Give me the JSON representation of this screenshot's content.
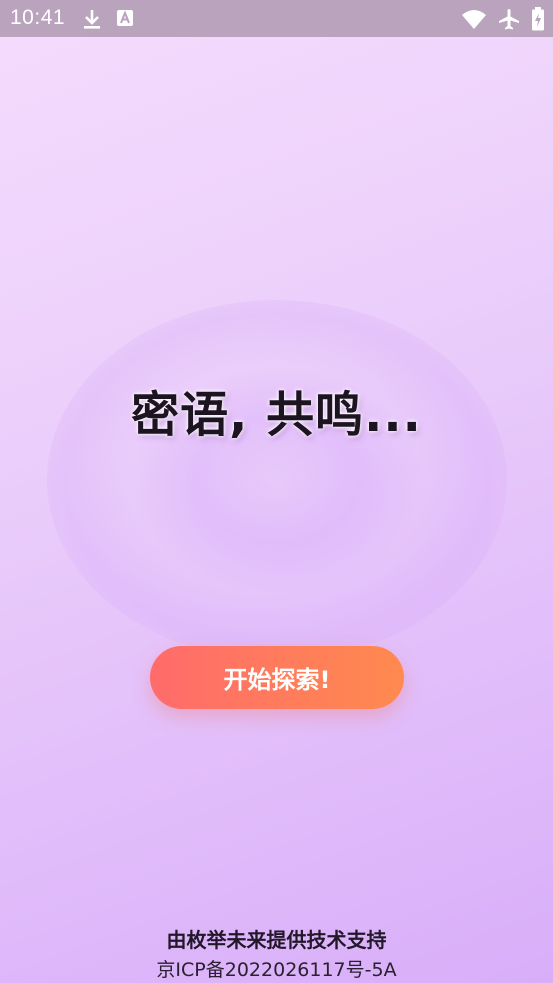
{
  "status_bar": {
    "time": "10:41",
    "left_icons": [
      "download-icon",
      "font-a-icon"
    ],
    "right_icons": [
      "wifi-icon",
      "airplane-icon",
      "battery-charging-icon"
    ],
    "background": "#b9a3bd"
  },
  "main": {
    "headline": "密语, 共鸣...",
    "start_button_label": "开始探索!"
  },
  "footer": {
    "support_text": "由枚举未来提供技术支持",
    "icp_text": "京ICP备2022026117号-5A"
  },
  "colors": {
    "background_top": "#f5dcfc",
    "background_bottom": "#d8aef9",
    "button_gradient_start": "#ff6b6b",
    "button_gradient_end": "#ff8a4f",
    "headline": "#1c1420"
  }
}
